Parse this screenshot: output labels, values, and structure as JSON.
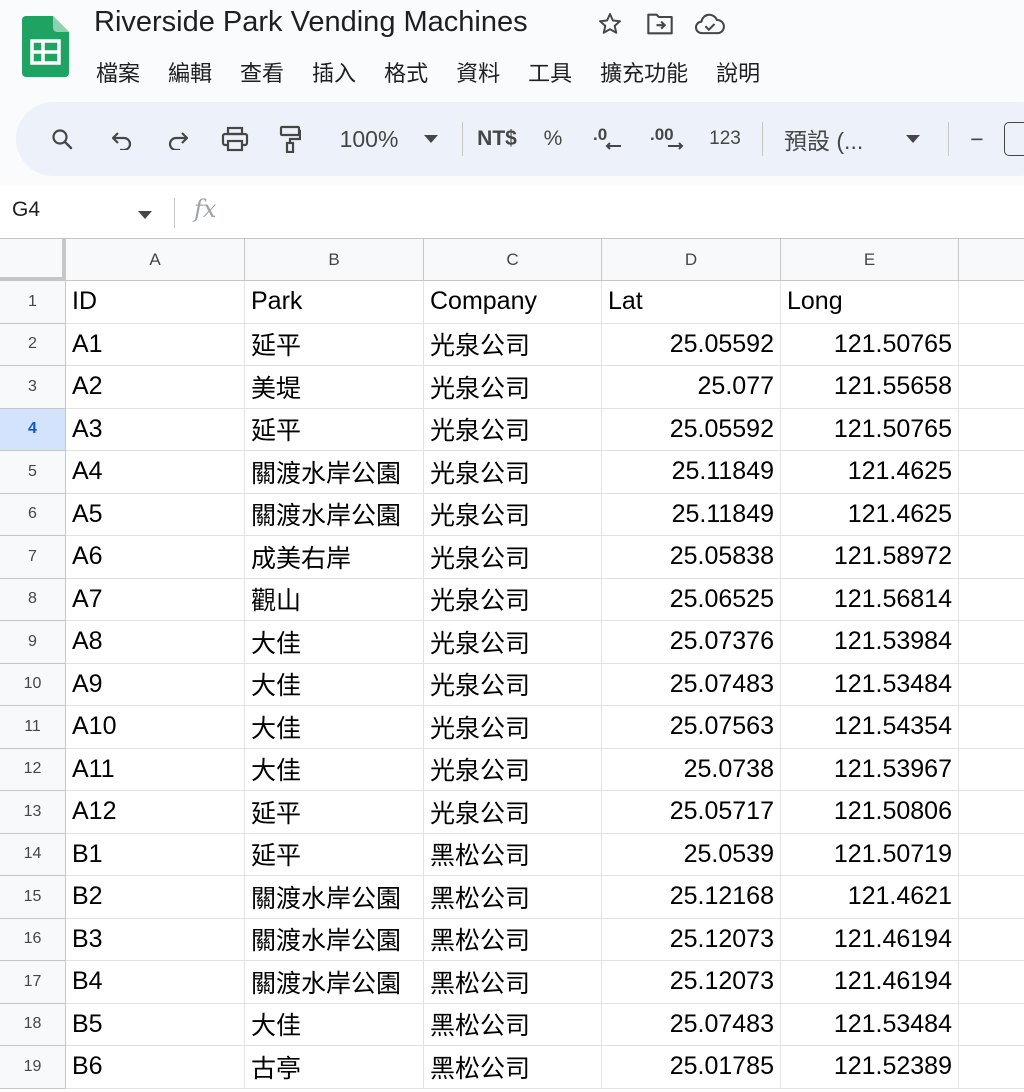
{
  "app": {
    "doc_title": "Riverside Park Vending Machines",
    "icons": [
      "star-icon",
      "move-to-folder-icon",
      "cloud-saved-icon"
    ]
  },
  "menu": [
    "檔案",
    "編輯",
    "查看",
    "插入",
    "格式",
    "資料",
    "工具",
    "擴充功能",
    "說明"
  ],
  "toolbar": {
    "zoom": "100%",
    "currency": "NT$",
    "percent": "%",
    "decrease_decimal": ".0",
    "increase_decimal": ".00",
    "number_format": "123",
    "font": "預設 (...",
    "minus": "−"
  },
  "formula_bar": {
    "name_box": "G4",
    "fx": "fx",
    "value": ""
  },
  "sheet": {
    "columns": [
      "A",
      "B",
      "C",
      "D",
      "E"
    ],
    "active_row": 4,
    "rows": [
      {
        "n": "1",
        "cells": [
          "ID",
          "Park",
          "Company",
          "Lat",
          "Long"
        ]
      },
      {
        "n": "2",
        "cells": [
          "A1",
          "延平",
          "光泉公司",
          "25.05592",
          "121.50765"
        ]
      },
      {
        "n": "3",
        "cells": [
          "A2",
          "美堤",
          "光泉公司",
          "25.077",
          "121.55658"
        ]
      },
      {
        "n": "4",
        "cells": [
          "A3",
          "延平",
          "光泉公司",
          "25.05592",
          "121.50765"
        ]
      },
      {
        "n": "5",
        "cells": [
          "A4",
          "關渡水岸公園",
          "光泉公司",
          "25.11849",
          "121.4625"
        ]
      },
      {
        "n": "6",
        "cells": [
          "A5",
          "關渡水岸公園",
          "光泉公司",
          "25.11849",
          "121.4625"
        ]
      },
      {
        "n": "7",
        "cells": [
          "A6",
          "成美右岸",
          "光泉公司",
          "25.05838",
          "121.58972"
        ]
      },
      {
        "n": "8",
        "cells": [
          "A7",
          "觀山",
          "光泉公司",
          "25.06525",
          "121.56814"
        ]
      },
      {
        "n": "9",
        "cells": [
          "A8",
          "大佳",
          "光泉公司",
          "25.07376",
          "121.53984"
        ]
      },
      {
        "n": "10",
        "cells": [
          "A9",
          "大佳",
          "光泉公司",
          "25.07483",
          "121.53484"
        ]
      },
      {
        "n": "11",
        "cells": [
          "A10",
          "大佳",
          "光泉公司",
          "25.07563",
          "121.54354"
        ]
      },
      {
        "n": "12",
        "cells": [
          "A11",
          "大佳",
          "光泉公司",
          "25.0738",
          "121.53967"
        ]
      },
      {
        "n": "13",
        "cells": [
          "A12",
          "延平",
          "光泉公司",
          "25.05717",
          "121.50806"
        ]
      },
      {
        "n": "14",
        "cells": [
          "B1",
          "延平",
          "黑松公司",
          "25.0539",
          "121.50719"
        ]
      },
      {
        "n": "15",
        "cells": [
          "B2",
          "關渡水岸公園",
          "黑松公司",
          "25.12168",
          "121.4621"
        ]
      },
      {
        "n": "16",
        "cells": [
          "B3",
          "關渡水岸公園",
          "黑松公司",
          "25.12073",
          "121.46194"
        ]
      },
      {
        "n": "17",
        "cells": [
          "B4",
          "關渡水岸公園",
          "黑松公司",
          "25.12073",
          "121.46194"
        ]
      },
      {
        "n": "18",
        "cells": [
          "B5",
          "大佳",
          "黑松公司",
          "25.07483",
          "121.53484"
        ]
      },
      {
        "n": "19",
        "cells": [
          "B6",
          "古亭",
          "黑松公司",
          "25.01785",
          "121.52389"
        ]
      }
    ]
  },
  "colors": {
    "accent": "#0b57d0",
    "active_row_bg": "#d3e3fd",
    "toolbar_bg": "#edf2fa",
    "logo_green": "#0f9d58"
  }
}
